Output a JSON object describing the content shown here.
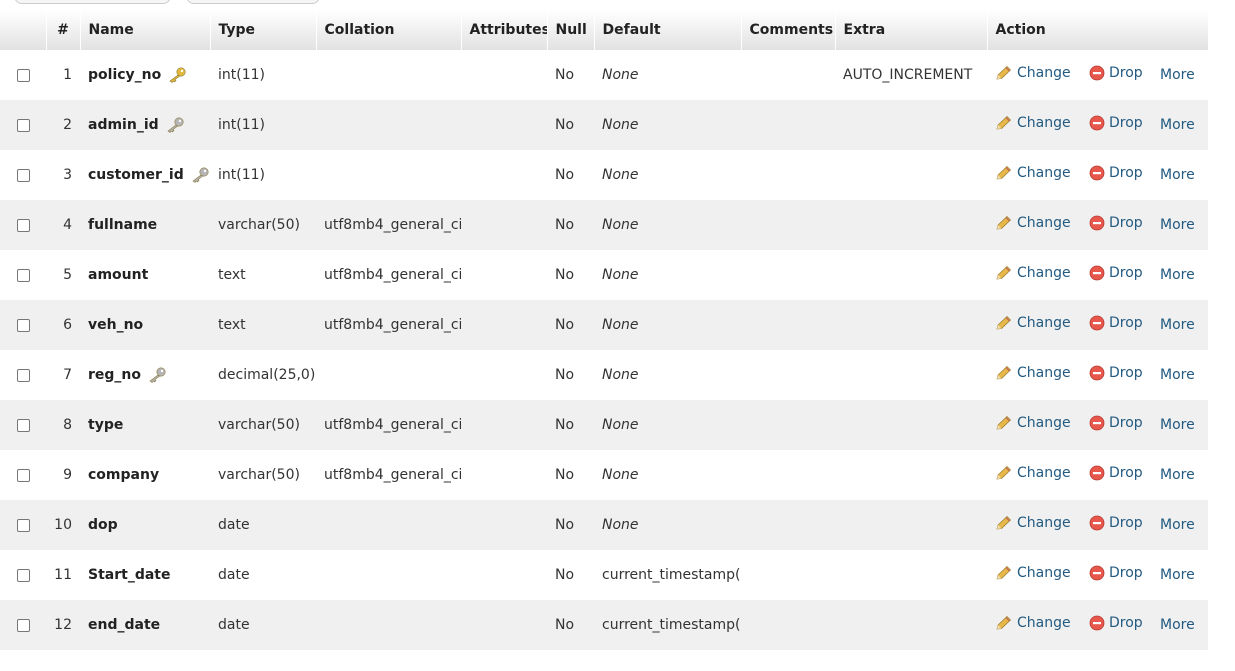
{
  "table": {
    "headers": [
      "#",
      "Name",
      "Type",
      "Collation",
      "Attributes",
      "Null",
      "Default",
      "Comments",
      "Extra",
      "Action"
    ],
    "actions": {
      "change": "Change",
      "drop": "Drop",
      "more": "More"
    },
    "rows": [
      {
        "num": "1",
        "name": "policy_no",
        "key": "primary",
        "type": "int(11)",
        "collation": "",
        "attributes": "",
        "null": "No",
        "default": "None",
        "default_italic": true,
        "comments": "",
        "extra": "AUTO_INCREMENT"
      },
      {
        "num": "2",
        "name": "admin_id",
        "key": "index",
        "type": "int(11)",
        "collation": "",
        "attributes": "",
        "null": "No",
        "default": "None",
        "default_italic": true,
        "comments": "",
        "extra": ""
      },
      {
        "num": "3",
        "name": "customer_id",
        "key": "index",
        "type": "int(11)",
        "collation": "",
        "attributes": "",
        "null": "No",
        "default": "None",
        "default_italic": true,
        "comments": "",
        "extra": ""
      },
      {
        "num": "4",
        "name": "fullname",
        "key": "",
        "type": "varchar(50)",
        "collation": "utf8mb4_general_ci",
        "attributes": "",
        "null": "No",
        "default": "None",
        "default_italic": true,
        "comments": "",
        "extra": ""
      },
      {
        "num": "5",
        "name": "amount",
        "key": "",
        "type": "text",
        "collation": "utf8mb4_general_ci",
        "attributes": "",
        "null": "No",
        "default": "None",
        "default_italic": true,
        "comments": "",
        "extra": ""
      },
      {
        "num": "6",
        "name": "veh_no",
        "key": "",
        "type": "text",
        "collation": "utf8mb4_general_ci",
        "attributes": "",
        "null": "No",
        "default": "None",
        "default_italic": true,
        "comments": "",
        "extra": ""
      },
      {
        "num": "7",
        "name": "reg_no",
        "key": "index",
        "type": "decimal(25,0)",
        "collation": "",
        "attributes": "",
        "null": "No",
        "default": "None",
        "default_italic": true,
        "comments": "",
        "extra": ""
      },
      {
        "num": "8",
        "name": "type",
        "key": "",
        "type": "varchar(50)",
        "collation": "utf8mb4_general_ci",
        "attributes": "",
        "null": "No",
        "default": "None",
        "default_italic": true,
        "comments": "",
        "extra": ""
      },
      {
        "num": "9",
        "name": "company",
        "key": "",
        "type": "varchar(50)",
        "collation": "utf8mb4_general_ci",
        "attributes": "",
        "null": "No",
        "default": "None",
        "default_italic": true,
        "comments": "",
        "extra": ""
      },
      {
        "num": "10",
        "name": "dop",
        "key": "",
        "type": "date",
        "collation": "",
        "attributes": "",
        "null": "No",
        "default": "None",
        "default_italic": true,
        "comments": "",
        "extra": ""
      },
      {
        "num": "11",
        "name": "Start_date",
        "key": "",
        "type": "date",
        "collation": "",
        "attributes": "",
        "null": "No",
        "default": "current_timestamp()",
        "default_italic": false,
        "comments": "",
        "extra": ""
      },
      {
        "num": "12",
        "name": "end_date",
        "key": "",
        "type": "date",
        "collation": "",
        "attributes": "",
        "null": "No",
        "default": "current_timestamp()",
        "default_italic": false,
        "comments": "",
        "extra": ""
      }
    ]
  },
  "icons": {
    "primary_key": "primary-key-icon",
    "index_key": "index-key-icon",
    "change": "pencil-icon",
    "drop": "drop-icon"
  },
  "colors": {
    "link": "#235a81",
    "primary_key": "#e2b93b",
    "index_key": "#b5b5b5",
    "drop": "#e8574c",
    "row_alt": "#f0f0f0"
  }
}
